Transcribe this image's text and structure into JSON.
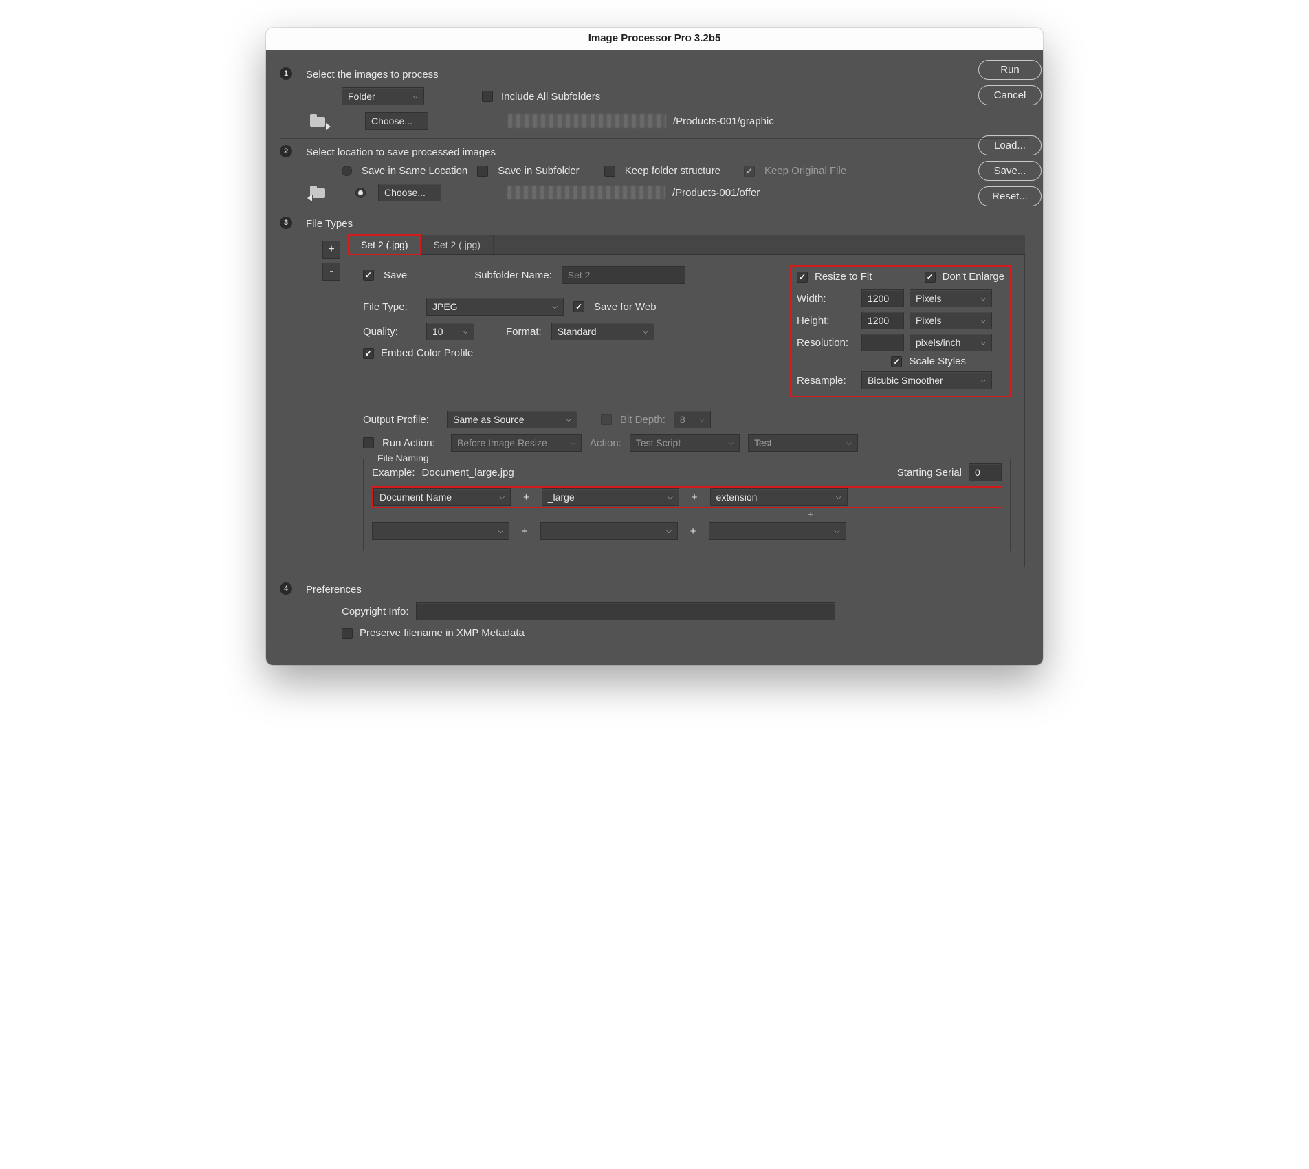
{
  "title": "Image Processor Pro 3.2b5",
  "buttons": {
    "run": "Run",
    "cancel": "Cancel",
    "load": "Load...",
    "save": "Save...",
    "reset": "Reset...",
    "choose": "Choose...",
    "add": "+",
    "remove": "-"
  },
  "section1": {
    "num": "1",
    "heading": "Select the images to process",
    "source": "Folder",
    "include_subfolders": "Include All Subfolders",
    "path_tail": "/Products-001/graphic"
  },
  "section2": {
    "num": "2",
    "heading": "Select location to save processed images",
    "same_loc": "Save in Same Location",
    "sub": "Save in Subfolder",
    "keep_struct": "Keep folder structure",
    "keep_orig": "Keep Original File",
    "path_tail": "/Products-001/offer"
  },
  "section3": {
    "num": "3",
    "heading": "File Types",
    "tabs": [
      "Set 2 (.jpg)",
      "Set 2 (.jpg)"
    ],
    "save": "Save",
    "subfolder_label": "Subfolder Name:",
    "subfolder_value": "Set 2",
    "filetype_label": "File Type:",
    "filetype_value": "JPEG",
    "save_for_web": "Save for Web",
    "quality_label": "Quality:",
    "quality_value": "10",
    "format_label": "Format:",
    "format_value": "Standard",
    "embed": "Embed Color Profile",
    "resize": {
      "resize_fit": "Resize to Fit",
      "dont_enlarge": "Don't Enlarge",
      "width_label": "Width:",
      "width_value": "1200",
      "width_unit": "Pixels",
      "height_label": "Height:",
      "height_value": "1200",
      "height_unit": "Pixels",
      "res_label": "Resolution:",
      "res_value": "",
      "res_unit": "pixels/inch",
      "scale_styles": "Scale Styles",
      "resample_label": "Resample:",
      "resample_value": "Bicubic Smoother"
    },
    "output_profile_label": "Output Profile:",
    "output_profile_value": "Same as Source",
    "bitdepth_label": "Bit Depth:",
    "bitdepth_value": "8",
    "run_action_label": "Run Action:",
    "run_action_when": "Before Image Resize",
    "action_label": "Action:",
    "action_set": "Test Script",
    "action_name": "Test",
    "naming": {
      "legend": "File Naming",
      "example_label": "Example:",
      "example_value": "Document_large.jpg",
      "serial_label": "Starting Serial",
      "serial_value": "0",
      "slot1": "Document Name",
      "slot2": "_large",
      "slot3": "extension",
      "slot4": "",
      "slot5": "",
      "slot6": ""
    }
  },
  "section4": {
    "num": "4",
    "heading": "Preferences",
    "copyright_label": "Copyright Info:",
    "copyright_value": "",
    "preserve": "Preserve filename in XMP Metadata"
  }
}
